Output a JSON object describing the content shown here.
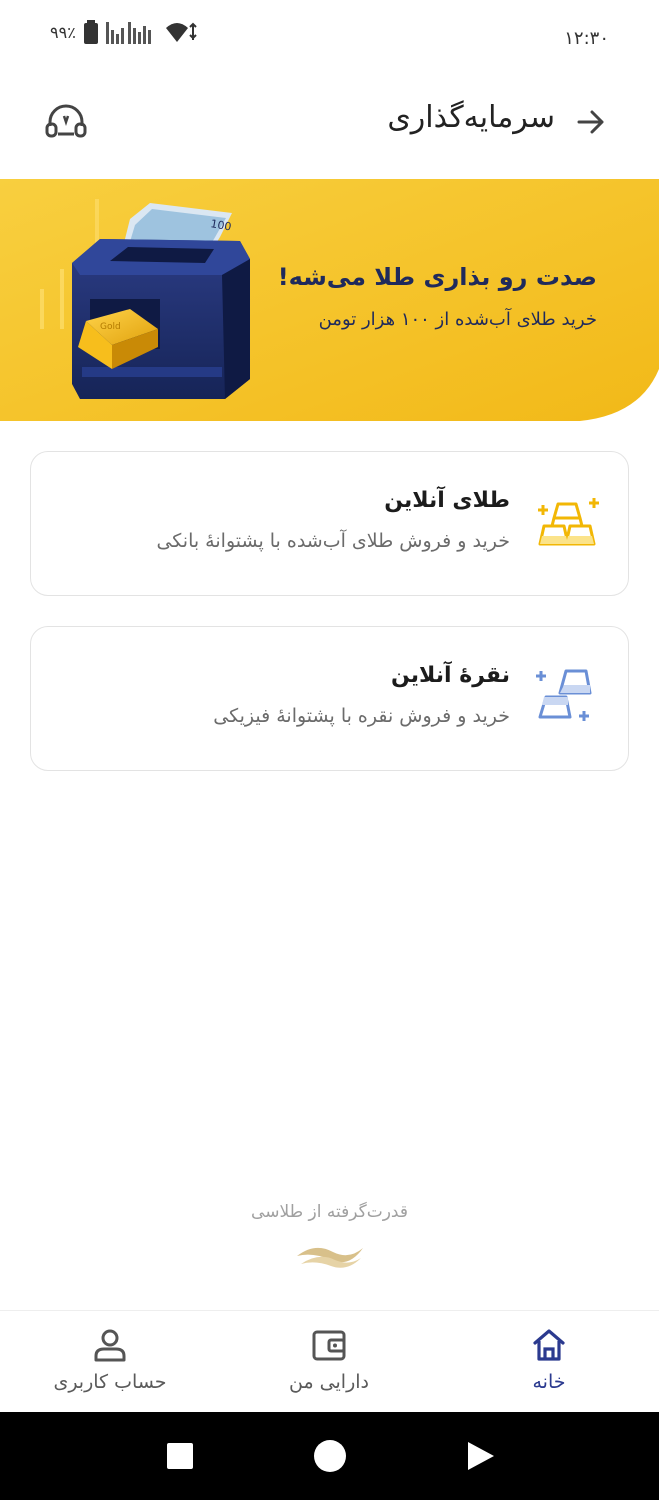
{
  "status_bar": {
    "time": "۱۲:۳۰",
    "battery": "۹۹٪"
  },
  "header": {
    "title": "سرمایه‌گذاری",
    "back_icon": "arrow-right-icon",
    "support_icon": "headset-support-icon"
  },
  "banner": {
    "title": "صدت رو بذاری طلا می‌شه!",
    "subtitle": "خرید طلای آب‌شده از ۱۰۰ هزار تومن",
    "bill_text": "100",
    "gold_bar_text": "Gold",
    "colors": {
      "background": "#f6c634",
      "text": "#1f2a5c"
    }
  },
  "products": [
    {
      "title": "طلای آنلاین",
      "subtitle": "خرید و فروش طلای آب‌شده با پشتوانهٔ بانکی",
      "icon": "gold-bars-icon",
      "color": "#f2b705"
    },
    {
      "title": "نقرهٔ آنلاین",
      "subtitle": "خرید و فروش نقره با پشتوانهٔ فیزیکی",
      "icon": "silver-bars-icon",
      "color": "#6a8fd6"
    }
  ],
  "footer": {
    "powered_by": "قدرت‌گرفته از طلاسی"
  },
  "bottom_nav": {
    "items": [
      {
        "label": "خانه",
        "icon": "home-icon",
        "active": true
      },
      {
        "label": "دارایی من",
        "icon": "wallet-icon",
        "active": false
      },
      {
        "label": "حساب کاربری",
        "icon": "user-icon",
        "active": false
      }
    ],
    "active_color": "#2b3a8f"
  }
}
